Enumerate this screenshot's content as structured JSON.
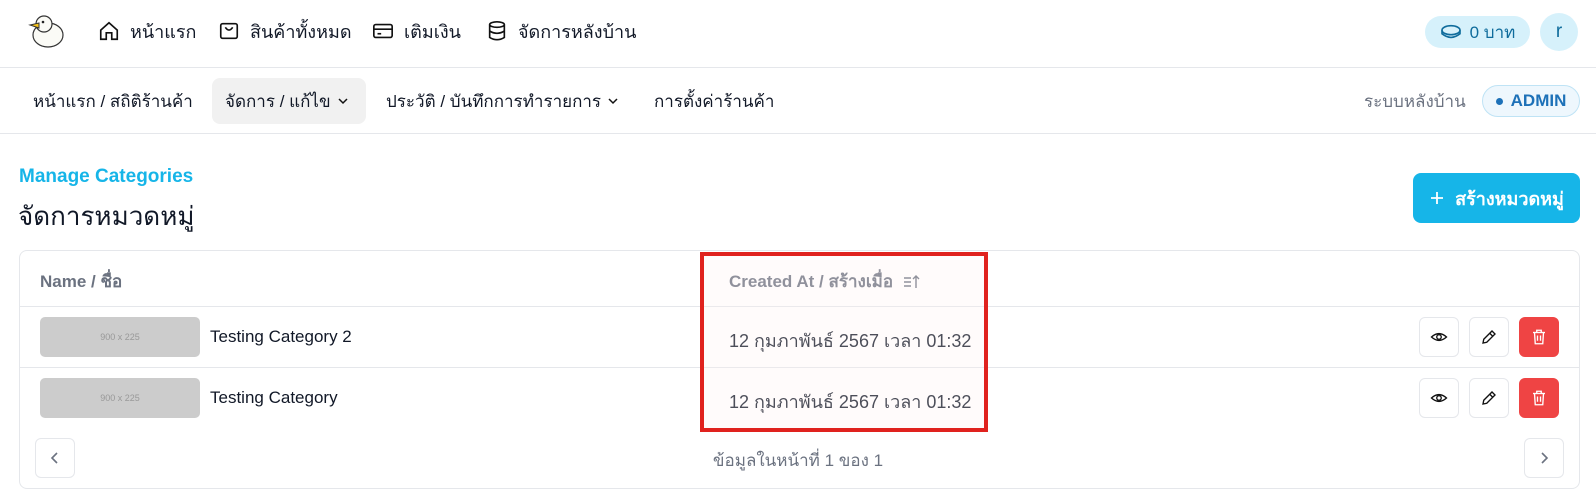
{
  "topnav": {
    "items": [
      {
        "label": "หน้าแรก",
        "icon": "home-icon"
      },
      {
        "label": "สินค้าทั้งหมด",
        "icon": "shopping-bag-icon"
      },
      {
        "label": "เติมเงิน",
        "icon": "credit-card-icon"
      },
      {
        "label": "จัดการหลังบ้าน",
        "icon": "database-icon"
      }
    ],
    "balance": "0 บาท",
    "avatar_initial": "r"
  },
  "subnav": {
    "items": [
      {
        "label": "หน้าแรก / สถิติร้านค้า"
      },
      {
        "label": "จัดการ / แก้ไข"
      },
      {
        "label": "ประวัติ / บันทึกการทำรายการ"
      },
      {
        "label": "การตั้งค่าร้านค้า"
      }
    ],
    "system_label": "ระบบหลังบ้าน",
    "role_badge": "ADMIN"
  },
  "header": {
    "eyebrow": "Manage Categories",
    "title": "จัดการหมวดหมู่",
    "create_button": "สร้างหมวดหมู่"
  },
  "table": {
    "columns": [
      "Name / ชื่อ",
      "Created At / สร้างเมื่อ"
    ],
    "rows": [
      {
        "thumbnail": "900 x 225",
        "name": "Testing Category 2",
        "created_at": "12 กุมภาพันธ์ 2567 เวลา 01:32"
      },
      {
        "thumbnail": "900 x 225",
        "name": "Testing Category",
        "created_at": "12 กุมภาพันธ์ 2567 เวลา 01:32"
      }
    ]
  },
  "pagination": {
    "info": "ข้อมูลในหน้าที่ 1 ของ 1"
  },
  "colors": {
    "accent": "#16b5e8",
    "danger": "#ef4444",
    "highlight": "#e0221e"
  }
}
